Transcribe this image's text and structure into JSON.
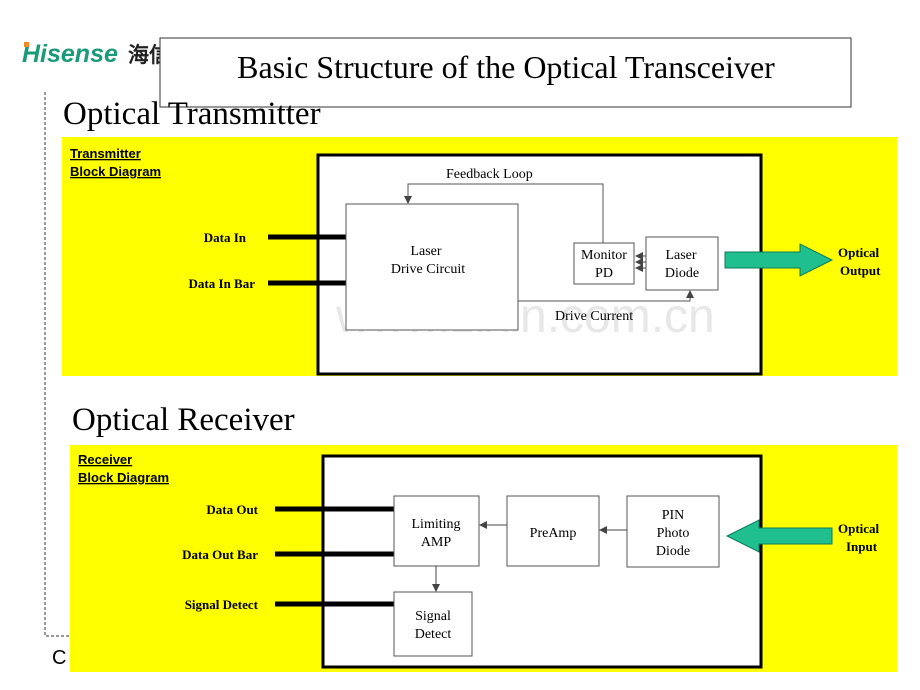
{
  "logo": {
    "text": "Hisense",
    "cjk": "海信",
    "color": "#1a9a78",
    "accent": "#f08a24"
  },
  "title": "Basic Structure of the Optical Transceiver",
  "transmitter": {
    "heading": "Optical Transmitter",
    "label_line1": "Transmitter",
    "label_line2": [
      "Block",
      "Diagram"
    ],
    "inputs": [
      "Data In",
      "Data In Bar"
    ],
    "blocks": {
      "laser_drive": [
        "Laser",
        "Drive Circuit"
      ],
      "monitor_pd": [
        "Monitor",
        "PD"
      ],
      "laser_diode": [
        "Laser",
        "Diode"
      ]
    },
    "feedback_label": "Feedback Loop",
    "drive_current_label": "Drive Current",
    "output_label": [
      "Optical",
      "Output"
    ]
  },
  "receiver": {
    "heading": "Optical Receiver",
    "label_line1": "Receiver",
    "label_line2": [
      "Block",
      "Diagram"
    ],
    "outputs": [
      "Data Out",
      "Data Out Bar",
      "Signal Detect"
    ],
    "blocks": {
      "limiting_amp": [
        "Limiting",
        "AMP"
      ],
      "preamp": [
        "PreAmp"
      ],
      "pin_photo_diode": [
        "PIN",
        "Photo",
        "Diode"
      ],
      "signal_detect": [
        "Signal",
        "Detect"
      ]
    },
    "input_label": [
      "Optical",
      "Input"
    ]
  },
  "watermark": "www.zixin.com.cn",
  "footer_fragment": "C",
  "colors": {
    "panel": "#ffff00",
    "arrow": "#1fc08e"
  }
}
